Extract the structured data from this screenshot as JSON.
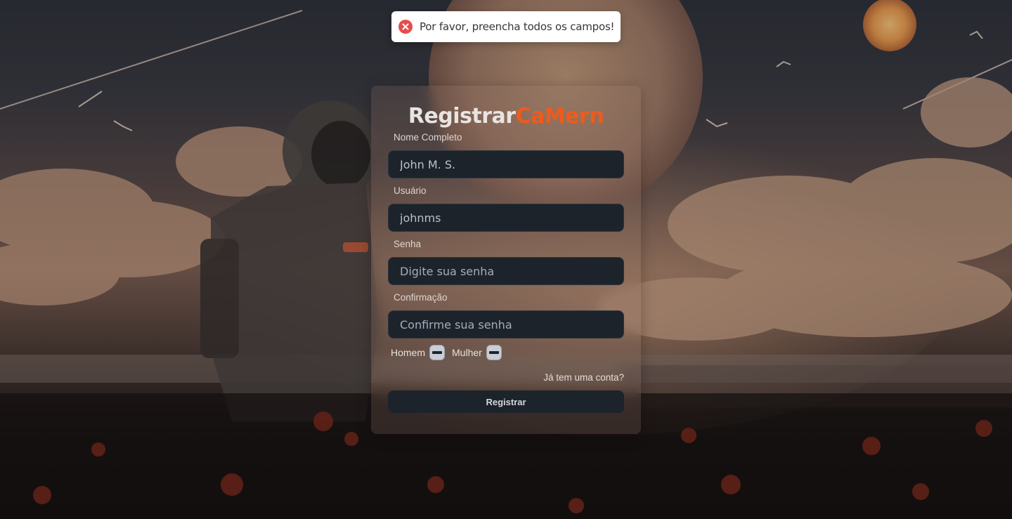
{
  "toast": {
    "icon": "error-x-icon",
    "message": "Por favor, preencha todos os campos!",
    "color": "#e74c4c"
  },
  "form": {
    "title_part1": "Registrar",
    "title_part2": "CaMern",
    "accent_color": "#f05a1a",
    "fullname": {
      "label": "Nome Completo",
      "value": "John M. S."
    },
    "username": {
      "label": "Usuário",
      "value": "johnms"
    },
    "password": {
      "label": "Senha",
      "placeholder": "Digite sua senha"
    },
    "confirm": {
      "label": "Confirmação",
      "placeholder": "Confirme sua senha"
    },
    "gender": {
      "male_label": "Homem",
      "female_label": "Mulher"
    },
    "login_link": "Já tem uma conta?",
    "submit_label": "Registrar"
  }
}
